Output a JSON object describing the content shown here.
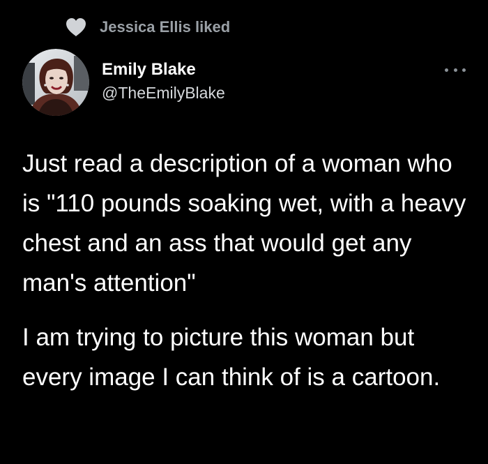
{
  "social_context": {
    "icon": "heart-icon",
    "text": "Jessica Ellis liked"
  },
  "author": {
    "display_name": "Emily Blake",
    "handle": "@TheEmilyBlake",
    "avatar": "avatar-photo"
  },
  "menu": {
    "icon": "more-options-icon"
  },
  "tweet": {
    "paragraphs": [
      "Just read a description of a woman who is \"110 pounds soaking wet, with a heavy chest and an ass that would get any man's attention\"",
      "I am trying to picture this woman but every image I can think of is a cartoon."
    ]
  },
  "colors": {
    "background": "#000000",
    "text": "#ffffff",
    "secondary": "#9aa0a6"
  }
}
